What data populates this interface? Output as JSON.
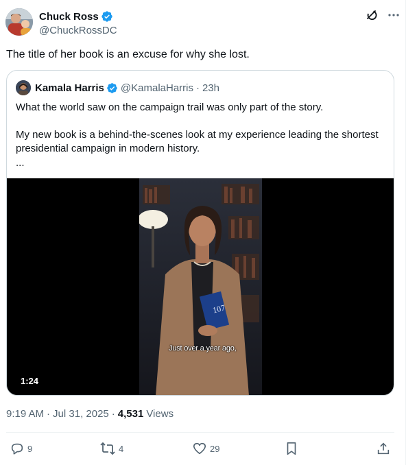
{
  "post": {
    "author": {
      "name": "Chuck Ross",
      "handle": "@ChuckRossDC"
    },
    "text": "The title of her book is an excuse for why she lost.",
    "header_icons": [
      "grok-icon",
      "more-icon"
    ],
    "quote": {
      "author": {
        "name": "Kamala Harris",
        "handle": "@KamalaHarris",
        "time": "23h"
      },
      "paragraph1": "What the world saw on the campaign trail was only part of the story.",
      "paragraph2": "My new book is a behind-the-scenes look at my experience leading the shortest presidential campaign in modern history.",
      "more": "...",
      "video": {
        "duration": "1:24",
        "caption": "Just over a year ago,",
        "book_number": "107"
      }
    },
    "meta": {
      "time": "9:19 AM",
      "date": "Jul 31, 2025",
      "views_count": "4,531",
      "views_label": "Views"
    },
    "actions": {
      "replies": "9",
      "reposts": "4",
      "likes": "29"
    },
    "colors": {
      "verified": "#1d9bf0",
      "secondary_text": "#536471",
      "border": "#cfd9de"
    }
  }
}
